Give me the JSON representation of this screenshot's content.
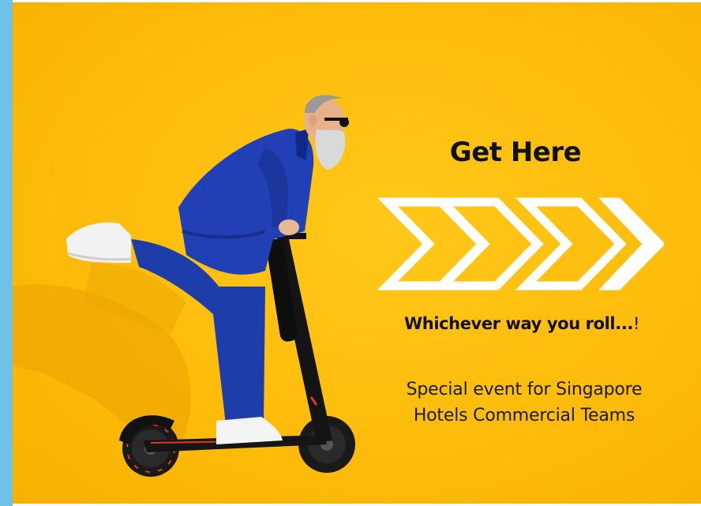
{
  "poster": {
    "headline": "Get Here",
    "tagline_main": "Whichever way you roll...",
    "tagline_end": "!",
    "event_line_1": "Special event for Singapore",
    "event_line_2": "Hotels Commercial Teams"
  },
  "colors": {
    "background": "#fdbc0b",
    "side_strip": "#6fc2e6",
    "suit": "#1f3fb0",
    "text": "#111111",
    "chevrons": "#ffffff"
  },
  "icons": {
    "arrows": "chevron-right-icon"
  }
}
